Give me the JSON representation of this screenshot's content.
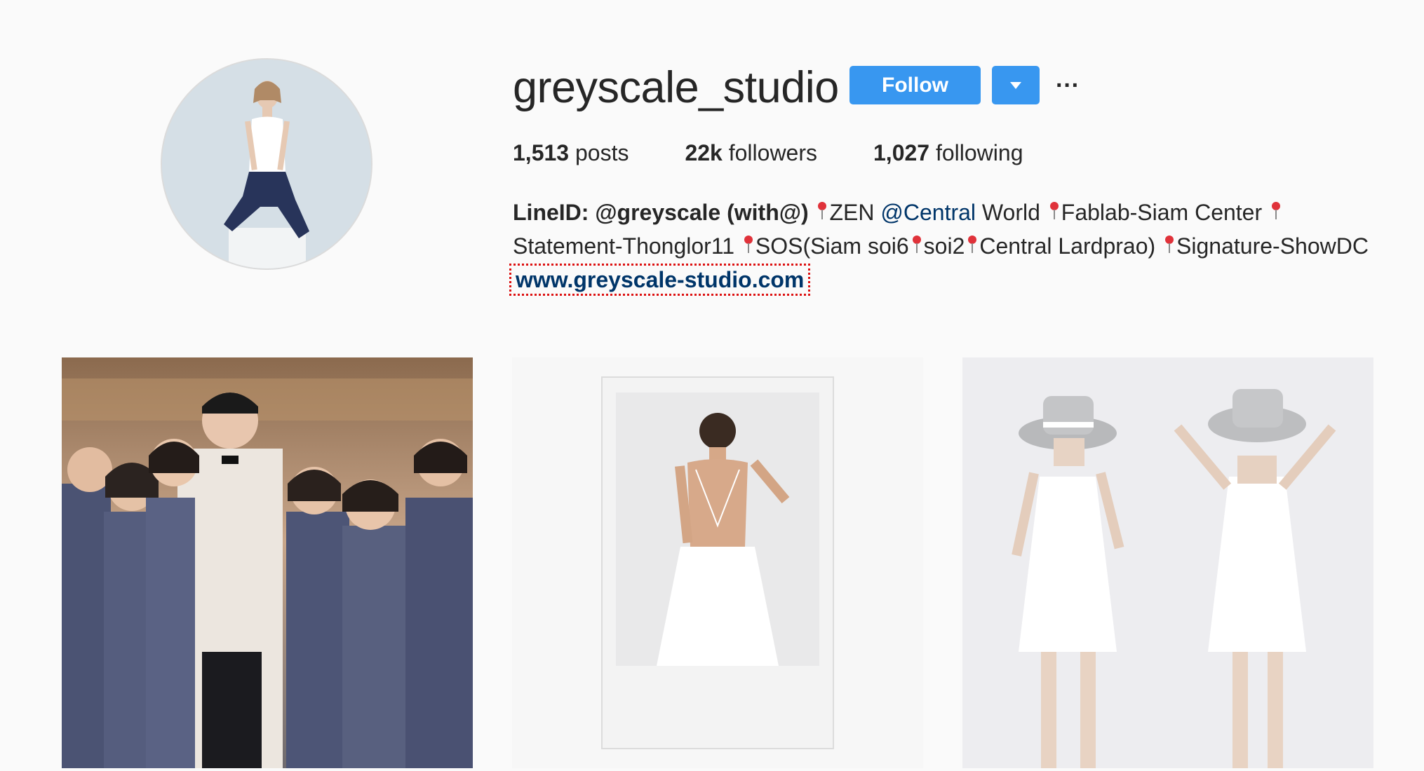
{
  "profile": {
    "username": "greyscale_studio",
    "follow_label": "Follow",
    "more_label": "···"
  },
  "stats": {
    "posts_count": "1,513",
    "posts_label": "posts",
    "followers_count": "22k",
    "followers_label": "followers",
    "following_count": "1,027",
    "following_label": "following"
  },
  "bio": {
    "line_id": "LineID: @greyscale (with@)",
    "t1": "ZEN ",
    "mention": "@Central",
    "t2": " World ",
    "t3": "Fablab-Siam Center ",
    "t4": "Statement-Thonglor11 ",
    "t5": "SOS(Siam soi6",
    "t6": "soi2",
    "t7": "Central Lardprao) ",
    "t8": "Signature-ShowDC",
    "website": "www.greyscale-studio.com"
  },
  "posts": [
    {
      "icon": "wedding-party-photo"
    },
    {
      "icon": "polaroid-white-dress-photo"
    },
    {
      "icon": "white-dresses-hats-photo"
    }
  ],
  "colors": {
    "background": "#fafafa",
    "follow_button": "#3897f0",
    "link": "#003569",
    "location_pin": "#e0323a",
    "highlight_outline": "#dd1111"
  }
}
